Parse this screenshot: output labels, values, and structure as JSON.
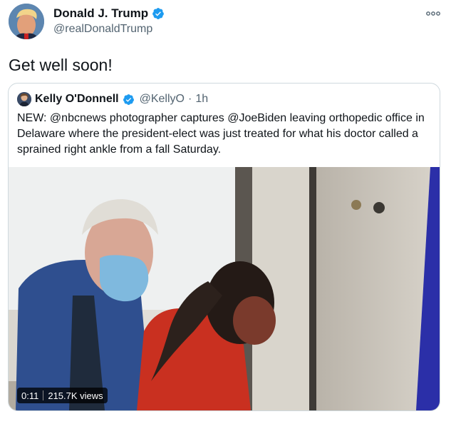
{
  "tweet": {
    "display_name": "Donald J. Trump",
    "handle": "@realDonaldTrump",
    "more_icon": "more-icon",
    "text": "Get well soon!"
  },
  "quote": {
    "display_name": "Kelly O'Donnell",
    "handle": "@KellyO",
    "separator": "·",
    "time": "1h",
    "text": "NEW:  @nbcnews photographer captures @JoeBiden leaving orthopedic office in Delaware where the president-elect was just treated for what his doctor called a sprained right ankle from a fall Saturday.",
    "video": {
      "duration": "0:11",
      "views": "215.7K views"
    }
  },
  "colors": {
    "verified": "#1d9bf0",
    "border": "#cfd9de",
    "secondary_text": "#536471"
  }
}
